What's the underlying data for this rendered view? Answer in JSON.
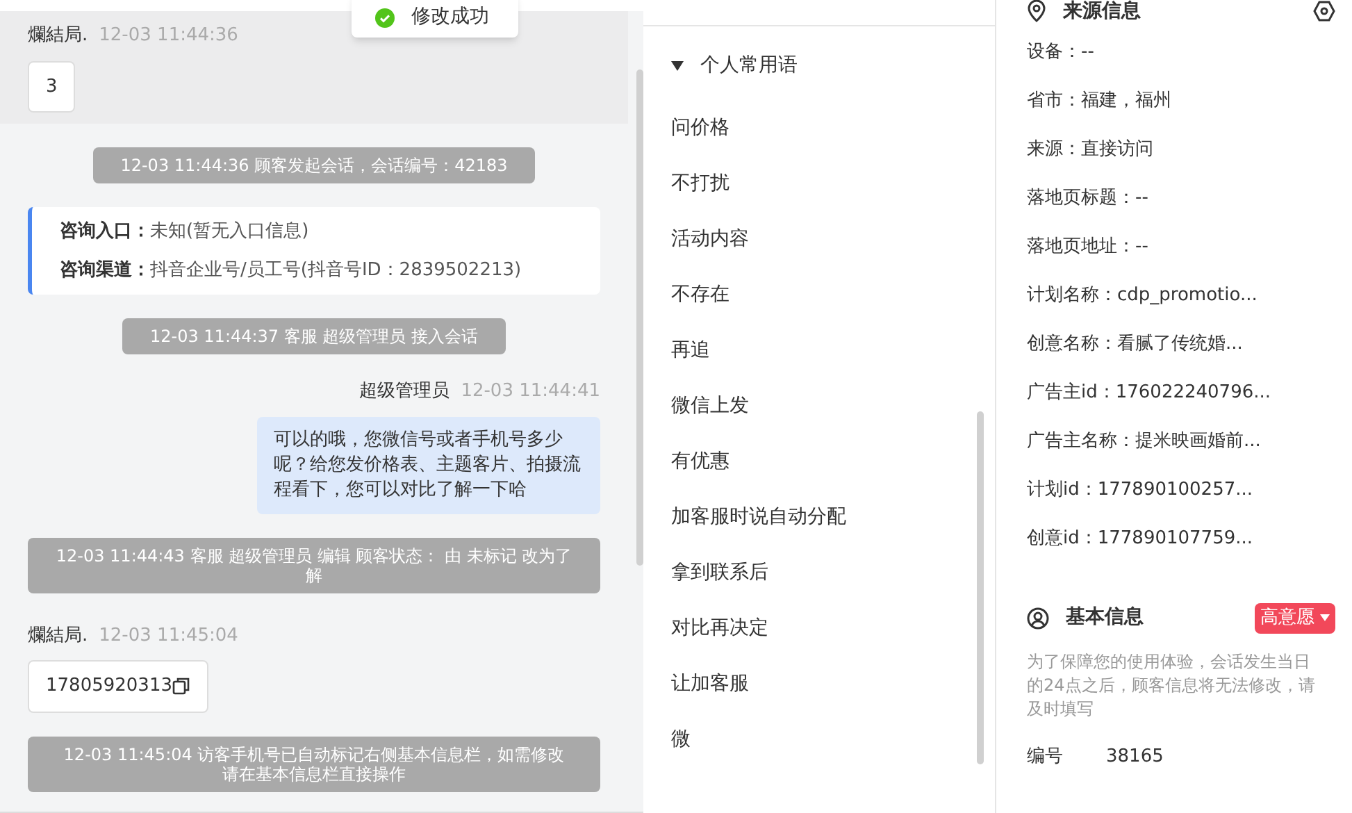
{
  "toast": {
    "text": "修改成功"
  },
  "chat": {
    "messages": [
      {
        "kind": "customer",
        "sender": "爛結局.",
        "time": "12-03 11:44:36",
        "text": "3",
        "copyable": false,
        "highlighted": true
      },
      {
        "kind": "system",
        "text": "12-03 11:44:36 顾客发起会话，会话编号：42183"
      },
      {
        "kind": "info",
        "rows": [
          {
            "label": "咨询入口：",
            "value": "未知(暂无入口信息)"
          },
          {
            "label": "咨询渠道：",
            "value": "抖音企业号/员工号(抖音号ID：2839502213)"
          }
        ]
      },
      {
        "kind": "system",
        "text": "12-03 11:44:37 客服 超级管理员 接入会话"
      },
      {
        "kind": "agent",
        "sender": "超级管理员",
        "time": "12-03 11:44:41",
        "text": "可以的哦，您微信号或者手机号多少呢？给您发价格表、主题客片、拍摄流程看下，您可以对比了解一下哈"
      },
      {
        "kind": "system",
        "text": "12-03 11:44:43 客服 超级管理员 编辑 顾客状态： 由 未标记 改为了解"
      },
      {
        "kind": "customer",
        "sender": "爛結局.",
        "time": "12-03 11:45:04",
        "text": "17805920313",
        "copyable": true,
        "highlighted": false
      },
      {
        "kind": "system",
        "text": "12-03 11:45:04 访客手机号已自动标记右侧基本信息栏，如需修改请在基本信息栏直接操作"
      }
    ]
  },
  "phrases": {
    "group": {
      "label": "个人常用语",
      "expanded": true
    },
    "items": [
      "问价格",
      "不打扰",
      "活动内容",
      "不存在",
      "再追",
      "微信上发",
      "有优惠",
      "加客服时说自动分配",
      "拿到联系后",
      "对比再决定",
      "让加客服",
      "微"
    ]
  },
  "source_info": {
    "title": "来源信息",
    "fields": [
      "设备：--",
      "省市：福建，福州",
      "来源：直接访问",
      "落地页标题：--",
      "落地页地址：--",
      "计划名称：cdp_promotio...",
      "创意名称：看腻了传统婚...",
      "广告主id：176022240796...",
      "广告主名称：提米映画婚前...",
      "计划id：177890100257...",
      "创意id：177890107759..."
    ]
  },
  "basic_info": {
    "title": "基本信息",
    "tag": "高意愿",
    "notice": "为了保障您的使用体验，会话发生当日的24点之后，顾客信息将无法修改，请及时填写",
    "fields": [
      {
        "label": "编号",
        "value": "38165"
      }
    ]
  }
}
